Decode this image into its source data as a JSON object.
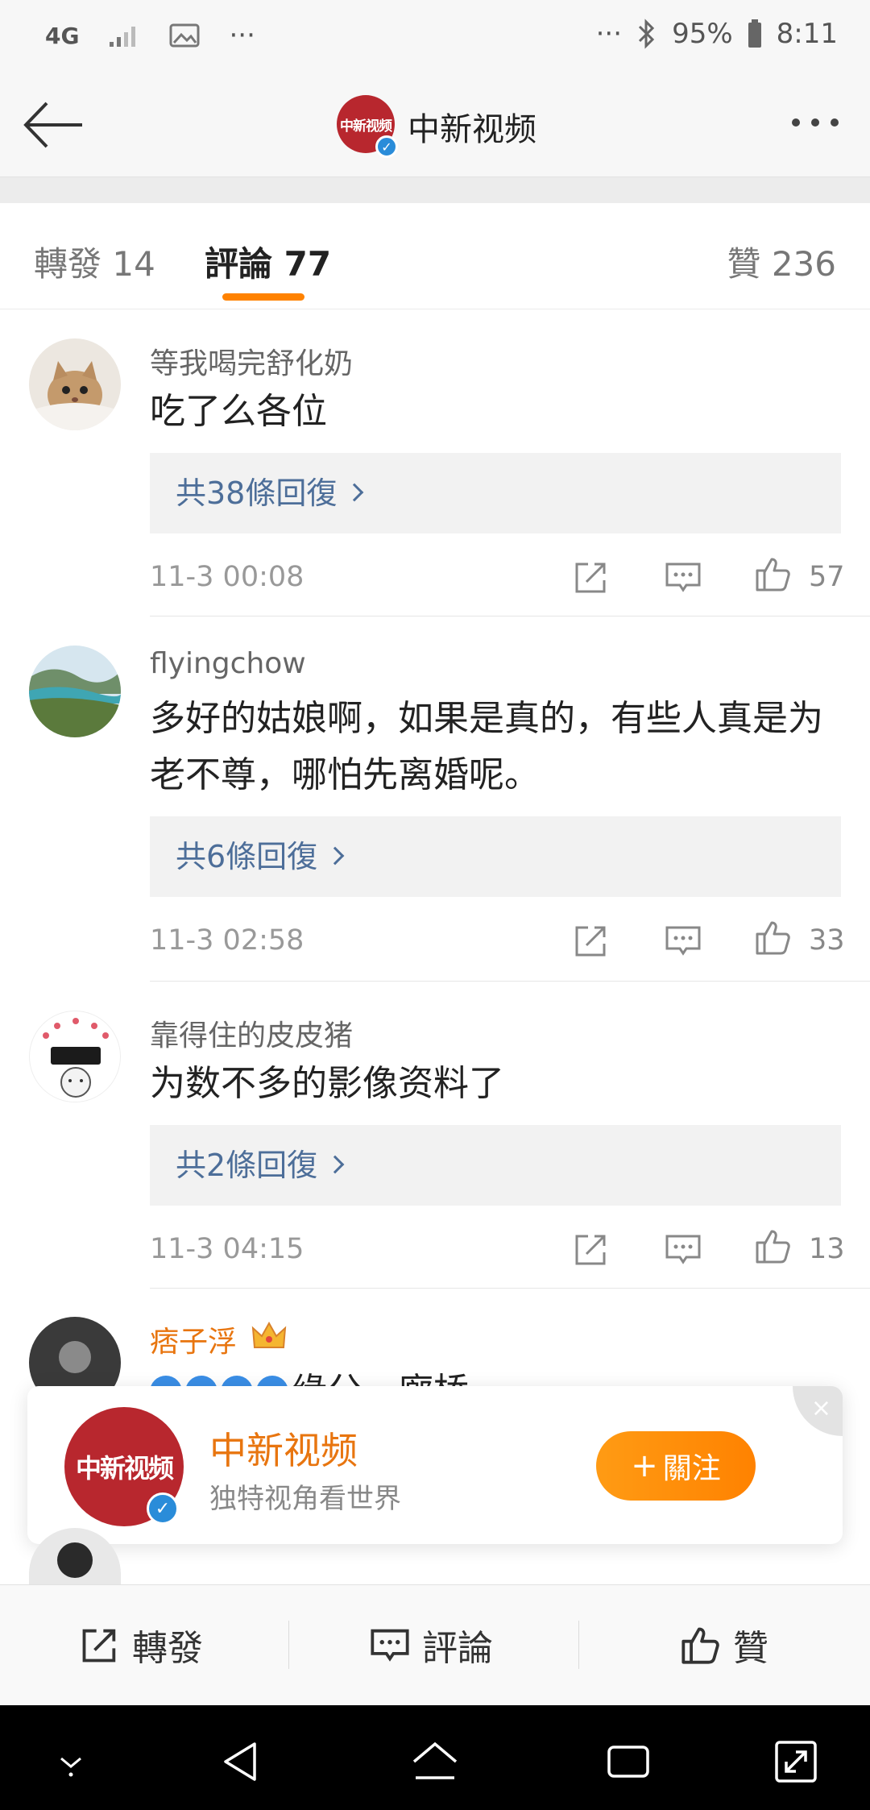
{
  "status_bar": {
    "network": "4G",
    "battery": "95%",
    "time": "8:11",
    "dots": "···"
  },
  "header": {
    "avatar_text": "中新视频",
    "title": "中新视频"
  },
  "tabs": {
    "repost": "轉發 14",
    "comments": "評論 77",
    "likes": "贊 236",
    "active_color": "#ff8200"
  },
  "comments": [
    {
      "user": "等我喝完舒化奶",
      "text": "吃了么各位",
      "replies": "共38條回復",
      "time": "11-3 00:08",
      "likes": "57"
    },
    {
      "user": "flyingchow",
      "text": "多好的姑娘啊，如果是真的，有些人真是为老不尊，哪怕先离婚呢。",
      "replies": "共6條回復",
      "time": "11-3 02:58",
      "likes": "33"
    },
    {
      "user": "靠得住的皮皮猪",
      "text": "为数不多的影像资料了",
      "replies": "共2條回復",
      "time": "11-3 04:15",
      "likes": "13"
    },
    {
      "user": "痞子浮",
      "text": "缘分，廊桥"
    }
  ],
  "follow_card": {
    "avatar_text": "中新视频",
    "name": "中新视频",
    "slogan": "独特视角看世界",
    "follow_label": "關注",
    "close": "×"
  },
  "bottom_bar": {
    "repost": "轉發",
    "comment": "評論",
    "like": "贊"
  },
  "colors": {
    "accent": "#ff8200",
    "link": "#4d6e99",
    "verified": "#2a8cd9",
    "brand_red": "#b8272e"
  }
}
